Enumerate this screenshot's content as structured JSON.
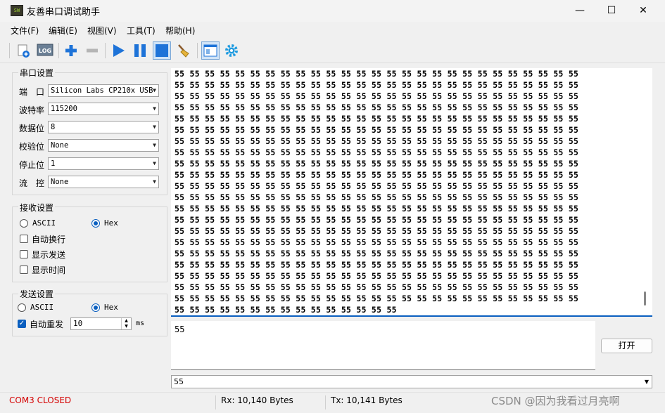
{
  "window": {
    "title": "友善串口调试助手",
    "icon_label": "SW",
    "controls": {
      "minimize": "—",
      "maximize": "☐",
      "close": "✕"
    }
  },
  "menu": [
    "文件(F)",
    "编辑(E)",
    "视图(V)",
    "工具(T)",
    "帮助(H)"
  ],
  "toolbar": {
    "icons": [
      "new-file-icon",
      "log-icon",
      "add-icon",
      "remove-icon",
      "play-icon",
      "pause-icon",
      "stop-icon",
      "clear-broom-icon",
      "window-layout-icon",
      "settings-gear-icon"
    ],
    "log_text": "LOG"
  },
  "serial_settings": {
    "title": "串口设置",
    "port_label": "端　口",
    "port_value": "Silicon Labs CP210x USB",
    "baud_label": "波特率",
    "baud_value": "115200",
    "databits_label": "数据位",
    "databits_value": "8",
    "parity_label": "校验位",
    "parity_value": "None",
    "stopbits_label": "停止位",
    "stopbits_value": "1",
    "flow_label": "流　控",
    "flow_value": "None"
  },
  "receive_settings": {
    "title": "接收设置",
    "ascii_label": "ASCII",
    "hex_label": "Hex",
    "selected": "Hex",
    "auto_wrap_label": "自动换行",
    "auto_wrap": false,
    "show_send_label": "显示发送",
    "show_send": false,
    "show_time_label": "显示时间",
    "show_time": false
  },
  "send_settings": {
    "title": "发送设置",
    "ascii_label": "ASCII",
    "hex_label": "Hex",
    "selected": "Hex",
    "auto_resend_label": "自动重发",
    "auto_resend": true,
    "interval_value": "10",
    "interval_unit": "ms"
  },
  "receive_area": {
    "byte": "55",
    "full_rows": 21,
    "bytes_per_row": 27,
    "last_row_bytes": 15
  },
  "send_area": {
    "text": "55",
    "open_button": "打开",
    "history_value": "55"
  },
  "status": {
    "port_state": "COM3 CLOSED",
    "rx": "Rx: 10,140 Bytes",
    "tx": "Tx: 10,141 Bytes",
    "watermark": "CSDN @因为我看过月亮啊"
  },
  "colors": {
    "accent": "#0a5fbf",
    "status_closed": "#d40000",
    "play_blue": "#1e73d8"
  }
}
